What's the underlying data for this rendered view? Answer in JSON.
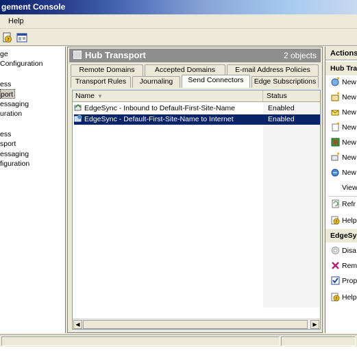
{
  "window": {
    "title": "gement Console"
  },
  "menu": {
    "help": "Help"
  },
  "tree": {
    "items": [
      {
        "label": "ge",
        "selected": false
      },
      {
        "label": "Configuration",
        "selected": false
      },
      {
        "label": "ess",
        "selected": false
      },
      {
        "label": "port",
        "selected": true
      },
      {
        "label": "essaging",
        "selected": false
      },
      {
        "label": "uration",
        "selected": false
      },
      {
        "label": "ess",
        "selected": false
      },
      {
        "label": "sport",
        "selected": false
      },
      {
        "label": "essaging",
        "selected": false
      },
      {
        "label": "figuration",
        "selected": false
      }
    ]
  },
  "hub": {
    "title": "Hub Transport",
    "count": "2 objects",
    "tabs_row1": [
      "Remote Domains",
      "Accepted Domains",
      "E-mail Address Policies"
    ],
    "tabs_row2": [
      "Transport Rules",
      "Journaling",
      "Send Connectors",
      "Edge Subscriptions"
    ],
    "active_tab": "Send Connectors",
    "columns": {
      "name": "Name",
      "status": "Status"
    },
    "rows": [
      {
        "name": "EdgeSync - Inbound to Default-First-Site-Name",
        "status": "Enabled",
        "selected": false
      },
      {
        "name": "EdgeSync - Default-First-Site-Name to Internet",
        "status": "Enabled",
        "selected": true
      }
    ]
  },
  "actions": {
    "title": "Actions",
    "hub_section": "Hub Tra",
    "hub_items": [
      {
        "label": "New",
        "icon": "new-remote-domain-icon"
      },
      {
        "label": "New",
        "icon": "new-accepted-domain-icon"
      },
      {
        "label": "New",
        "icon": "new-email-policy-icon"
      },
      {
        "label": "New",
        "icon": "new-transport-rule-icon"
      },
      {
        "label": "New",
        "icon": "new-journal-rule-icon"
      },
      {
        "label": "New",
        "icon": "new-send-connector-icon"
      },
      {
        "label": "New",
        "icon": "new-edge-subscription-icon"
      },
      {
        "label": "View",
        "icon": ""
      },
      {
        "label": "Refr",
        "icon": "refresh-icon"
      },
      {
        "label": "Help",
        "icon": "help-icon"
      }
    ],
    "edge_section": "EdgeSy",
    "edge_items": [
      {
        "label": "Disa",
        "icon": "disable-icon"
      },
      {
        "label": "Rem",
        "icon": "remove-icon"
      },
      {
        "label": "Prop",
        "icon": "properties-icon"
      },
      {
        "label": "Help",
        "icon": "help-icon"
      }
    ]
  },
  "colors": {
    "selection": "#0a246a",
    "header_gray": "#8e8e8e",
    "title_gradient_start": "#0a246a"
  }
}
